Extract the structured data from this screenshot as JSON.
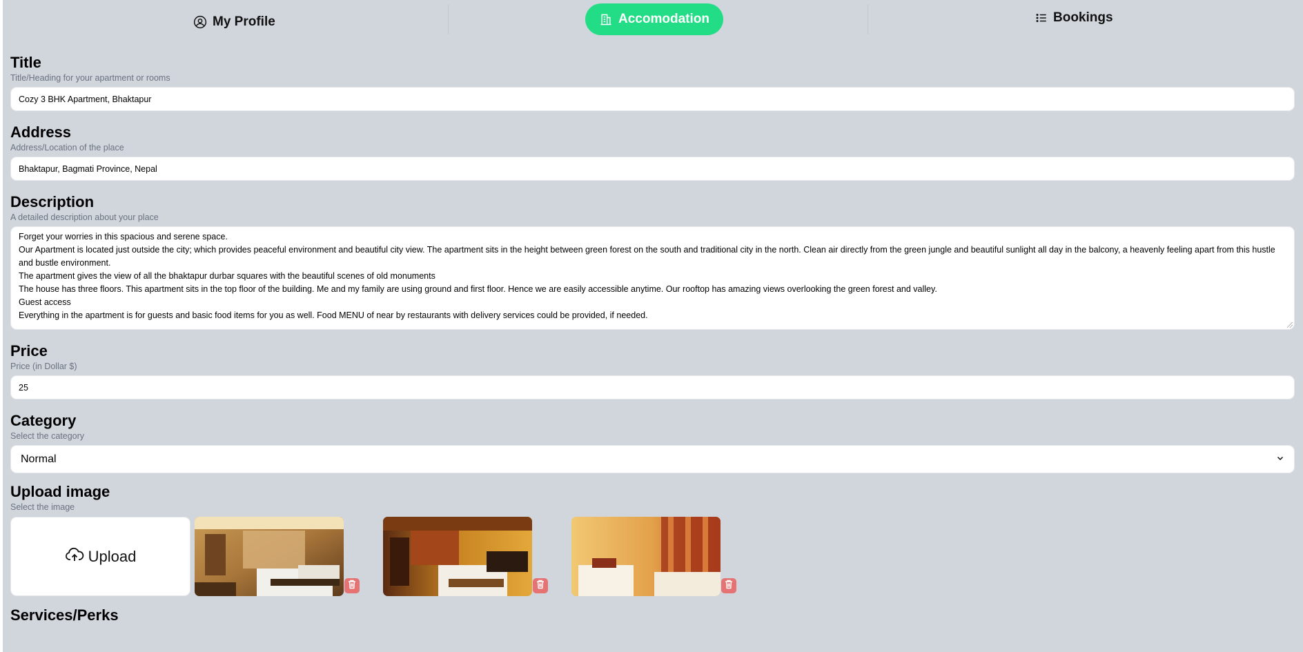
{
  "nav": {
    "profile_label": "My Profile",
    "accommodation_label": "Accomodation",
    "bookings_label": "Bookings",
    "accent_color": "#22dd85"
  },
  "form": {
    "title": {
      "label": "Title",
      "hint": "Title/Heading for your apartment or rooms",
      "value": "Cozy 3 BHK Apartment, Bhaktapur"
    },
    "address": {
      "label": "Address",
      "hint": "Address/Location of the place",
      "value": "Bhaktapur, Bagmati Province, Nepal"
    },
    "description": {
      "label": "Description",
      "hint": "A detailed description about your place",
      "value": "Forget your worries in this spacious and serene space.\nOur Apartment is located just outside the city; which provides peaceful environment and beautiful city view. The apartment sits in the height between green forest on the south and traditional city in the north. Clean air directly from the green jungle and beautiful sunlight all day in the balcony, a heavenly feeling apart from this hustle and bustle environment.\nThe apartment gives the view of all the bhaktapur durbar squares with the beautiful scenes of old monuments\nThe house has three floors. This apartment sits in the top floor of the building. Me and my family are using ground and first floor. Hence we are easily accessible anytime. Our rooftop has amazing views overlooking the green forest and valley.\nGuest access\nEverything in the apartment is for guests and basic food items for you as well. Food MENU of near by restaurants with delivery services could be provided, if needed."
    },
    "price": {
      "label": "Price",
      "hint": "Price (in Dollar $)",
      "value": "25"
    },
    "category": {
      "label": "Category",
      "hint": "Select the category",
      "selected": "Normal"
    },
    "upload": {
      "label": "Upload image",
      "hint": "Select the image",
      "button_label": "Upload"
    },
    "services_label": "Services/Perks"
  },
  "icons": {
    "profile": "user-circle-icon",
    "accommodation": "building-icon",
    "bookings": "list-icon",
    "upload": "cloud-upload-icon",
    "delete": "trash-icon"
  }
}
